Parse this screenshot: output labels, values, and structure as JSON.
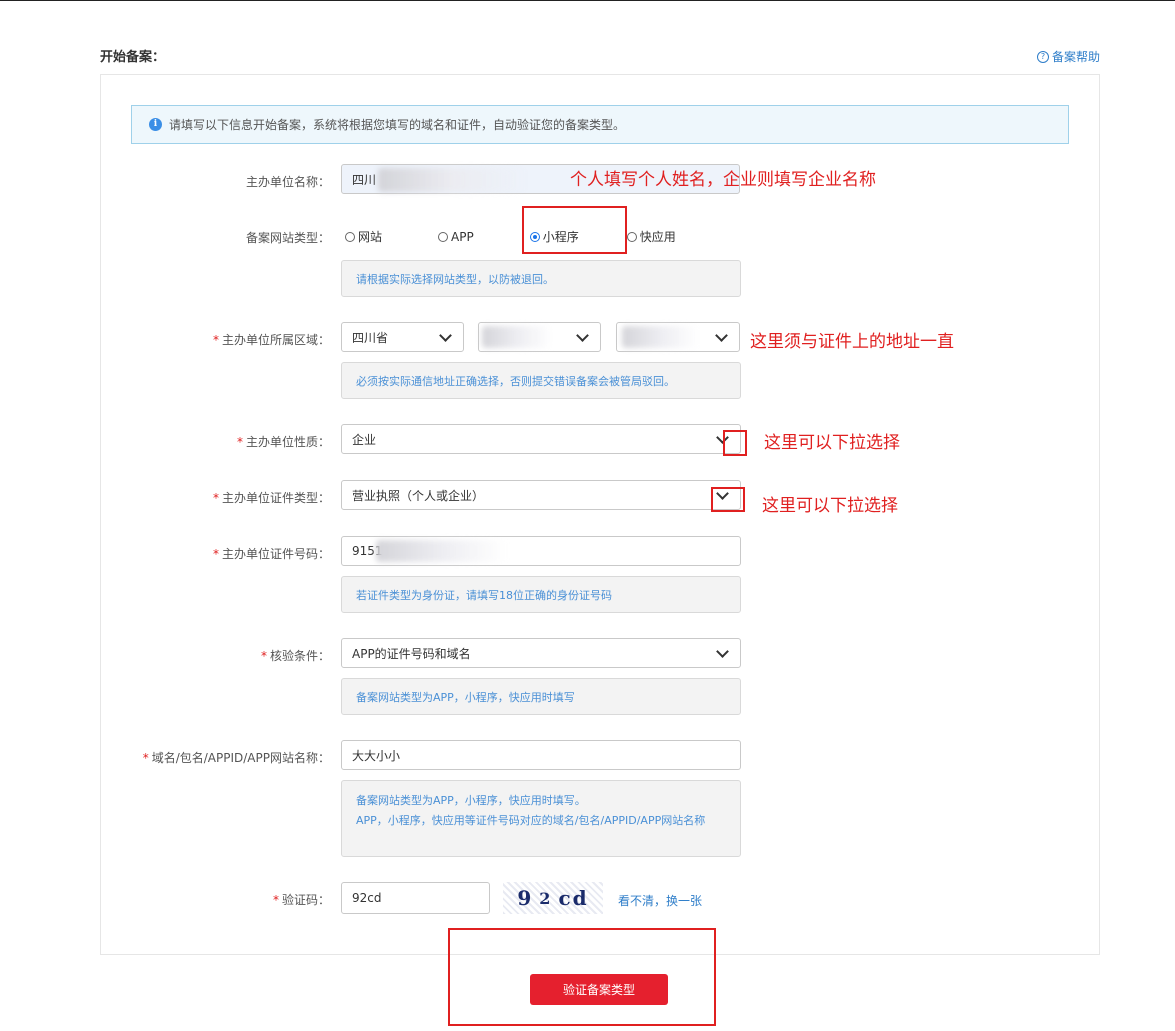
{
  "header": {
    "section_title": "开始备案：",
    "help_link": "备案帮助"
  },
  "notice": {
    "text": "请填写以下信息开始备案，系统将根据您填写的域名和证件，自动验证您的备案类型。"
  },
  "form": {
    "org_name": {
      "label": "主办单位名称：",
      "value": "四川"
    },
    "site_type": {
      "label": "备案网站类型：",
      "options": [
        "网站",
        "APP",
        "小程序",
        "快应用"
      ],
      "selected": "小程序",
      "hint": "请根据实际选择网站类型，以防被退回。"
    },
    "region": {
      "label": "主办单位所属区域：",
      "province": "四川省",
      "hint": "必须按实际通信地址正确选择，否则提交错误备案会被管局驳回。"
    },
    "org_nature": {
      "label": "主办单位性质：",
      "value": "企业"
    },
    "cert_type": {
      "label": "主办单位证件类型：",
      "value": "营业执照（个人或企业）"
    },
    "cert_number": {
      "label": "主办单位证件号码：",
      "value": "9151",
      "hint": "若证件类型为身份证，请填写18位正确的身份证号码"
    },
    "verify_condition": {
      "label": "核验条件：",
      "value": "APP的证件号码和域名",
      "hint": "备案网站类型为APP，小程序，快应用时填写"
    },
    "domain": {
      "label": "域名/包名/APPID/APP网站名称：",
      "value": "大大小小",
      "hint_line1": "备案网站类型为APP，小程序，快应用时填写。",
      "hint_line2": "APP，小程序，快应用等证件号码对应的域名/包名/APPID/APP网站名称"
    },
    "captcha": {
      "label": "验证码：",
      "value": "92cd",
      "image_chars": [
        "9",
        "2",
        "cd"
      ],
      "refresh_link": "看不清，换一张"
    },
    "submit_label": "验证备案类型",
    "required_mark": "*"
  },
  "annotations": {
    "org_name_note": "个人填写个人姓名，企业则填写企业名称",
    "region_note": "这里须与证件上的地址一直",
    "dropdown_note": "这里可以下拉选择"
  },
  "colors": {
    "accent_red": "#e5202e",
    "annotation_red": "#e02020",
    "link_blue": "#2f7ec9",
    "hint_blue": "#4a90d6"
  }
}
